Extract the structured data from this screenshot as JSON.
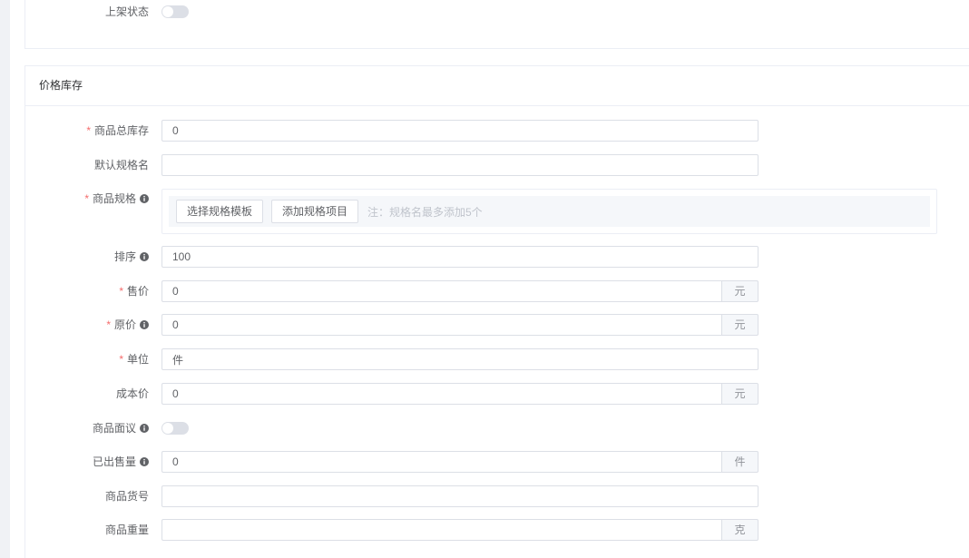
{
  "icons": {
    "info": "info-circle-icon"
  },
  "colors": {
    "required": "#f56c6c",
    "toggle_off": "#dcdfe6",
    "addon_bg": "#f5f7fa"
  },
  "required_mark": "*",
  "status": {
    "label": "上架状态",
    "enabled": false
  },
  "section": {
    "title": "价格库存",
    "total_stock": {
      "label": "商品总库存",
      "required": true,
      "value": "0"
    },
    "default_spec_name": {
      "label": "默认规格名",
      "value": ""
    },
    "spec": {
      "label": "商品规格",
      "required": true,
      "has_info": true,
      "select_template_button": "选择规格模板",
      "add_item_button": "添加规格项目",
      "note": "注：规格名最多添加5个"
    },
    "sort": {
      "label": "排序",
      "has_info": true,
      "value": "100"
    },
    "price": {
      "label": "售价",
      "required": true,
      "value": "0",
      "unit": "元"
    },
    "original_price": {
      "label": "原价",
      "required": true,
      "has_info": true,
      "value": "0",
      "unit": "元"
    },
    "unit": {
      "label": "单位",
      "required": true,
      "value": "件"
    },
    "cost_price": {
      "label": "成本价",
      "value": "0",
      "unit": "元"
    },
    "negotiable": {
      "label": "商品面议",
      "has_info": true,
      "enabled": false
    },
    "sold_count": {
      "label": "已出售量",
      "has_info": true,
      "value": "0",
      "unit": "件"
    },
    "sku_code": {
      "label": "商品货号",
      "value": ""
    },
    "weight": {
      "label": "商品重量",
      "value": "",
      "unit": "克"
    }
  }
}
